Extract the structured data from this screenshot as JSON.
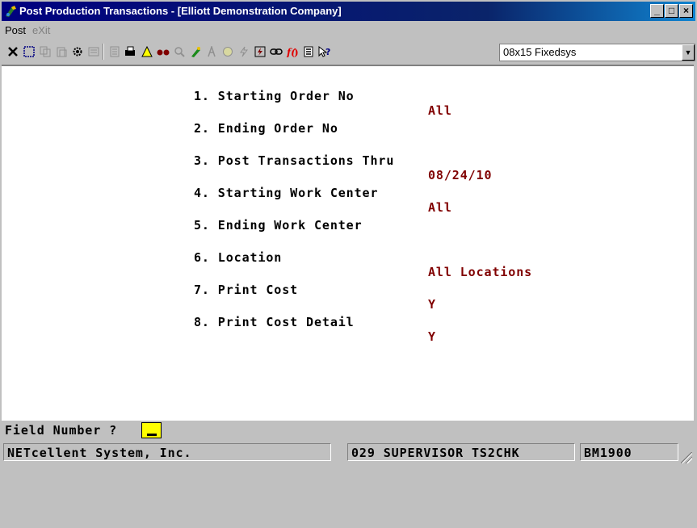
{
  "window": {
    "title": "Post Production Transactions - [Elliott Demonstration Company]",
    "controls": {
      "minimize": "_",
      "maximize": "□",
      "close": "×"
    }
  },
  "menu": {
    "items": [
      {
        "label": "Post",
        "enabled": true
      },
      {
        "label": "eXit",
        "enabled": false
      }
    ]
  },
  "toolbar": {
    "icons": [
      "cut-icon",
      "select-icon",
      "copy-icon",
      "paste-icon",
      "gear-icon",
      "properties-icon",
      "note-icon",
      "print-setup-icon",
      "alert-icon",
      "find-icon",
      "zoom-icon",
      "wizard-icon",
      "font-icon",
      "money-icon",
      "lightning-icon",
      "macro-icon",
      "link-icon",
      "function-icon",
      "list-icon",
      "help-icon"
    ],
    "font_combo": "08x15 Fixedsys"
  },
  "fields": [
    {
      "label": "1. Starting Order No",
      "value": "All"
    },
    {
      "label": "2. Ending Order No",
      "value": ""
    },
    {
      "label": "3. Post Transactions Thru",
      "value": "08/24/10"
    },
    {
      "label": "4. Starting Work Center",
      "value": "All"
    },
    {
      "label": "5. Ending Work Center",
      "value": ""
    },
    {
      "label": "6. Location",
      "value": "All Locations"
    },
    {
      "label": "7. Print Cost",
      "value": "Y"
    },
    {
      "label": "8. Print Cost Detail",
      "value": "Y"
    }
  ],
  "prompt": {
    "label": "Field Number ?",
    "value": ""
  },
  "status": {
    "company": "NETcellent System, Inc.",
    "user": "029 SUPERVISOR TS2CHK",
    "program": "BM1900"
  },
  "colors": {
    "title_bar": "#000080",
    "value_text": "#800000",
    "prompt_input": "#ffff00"
  }
}
